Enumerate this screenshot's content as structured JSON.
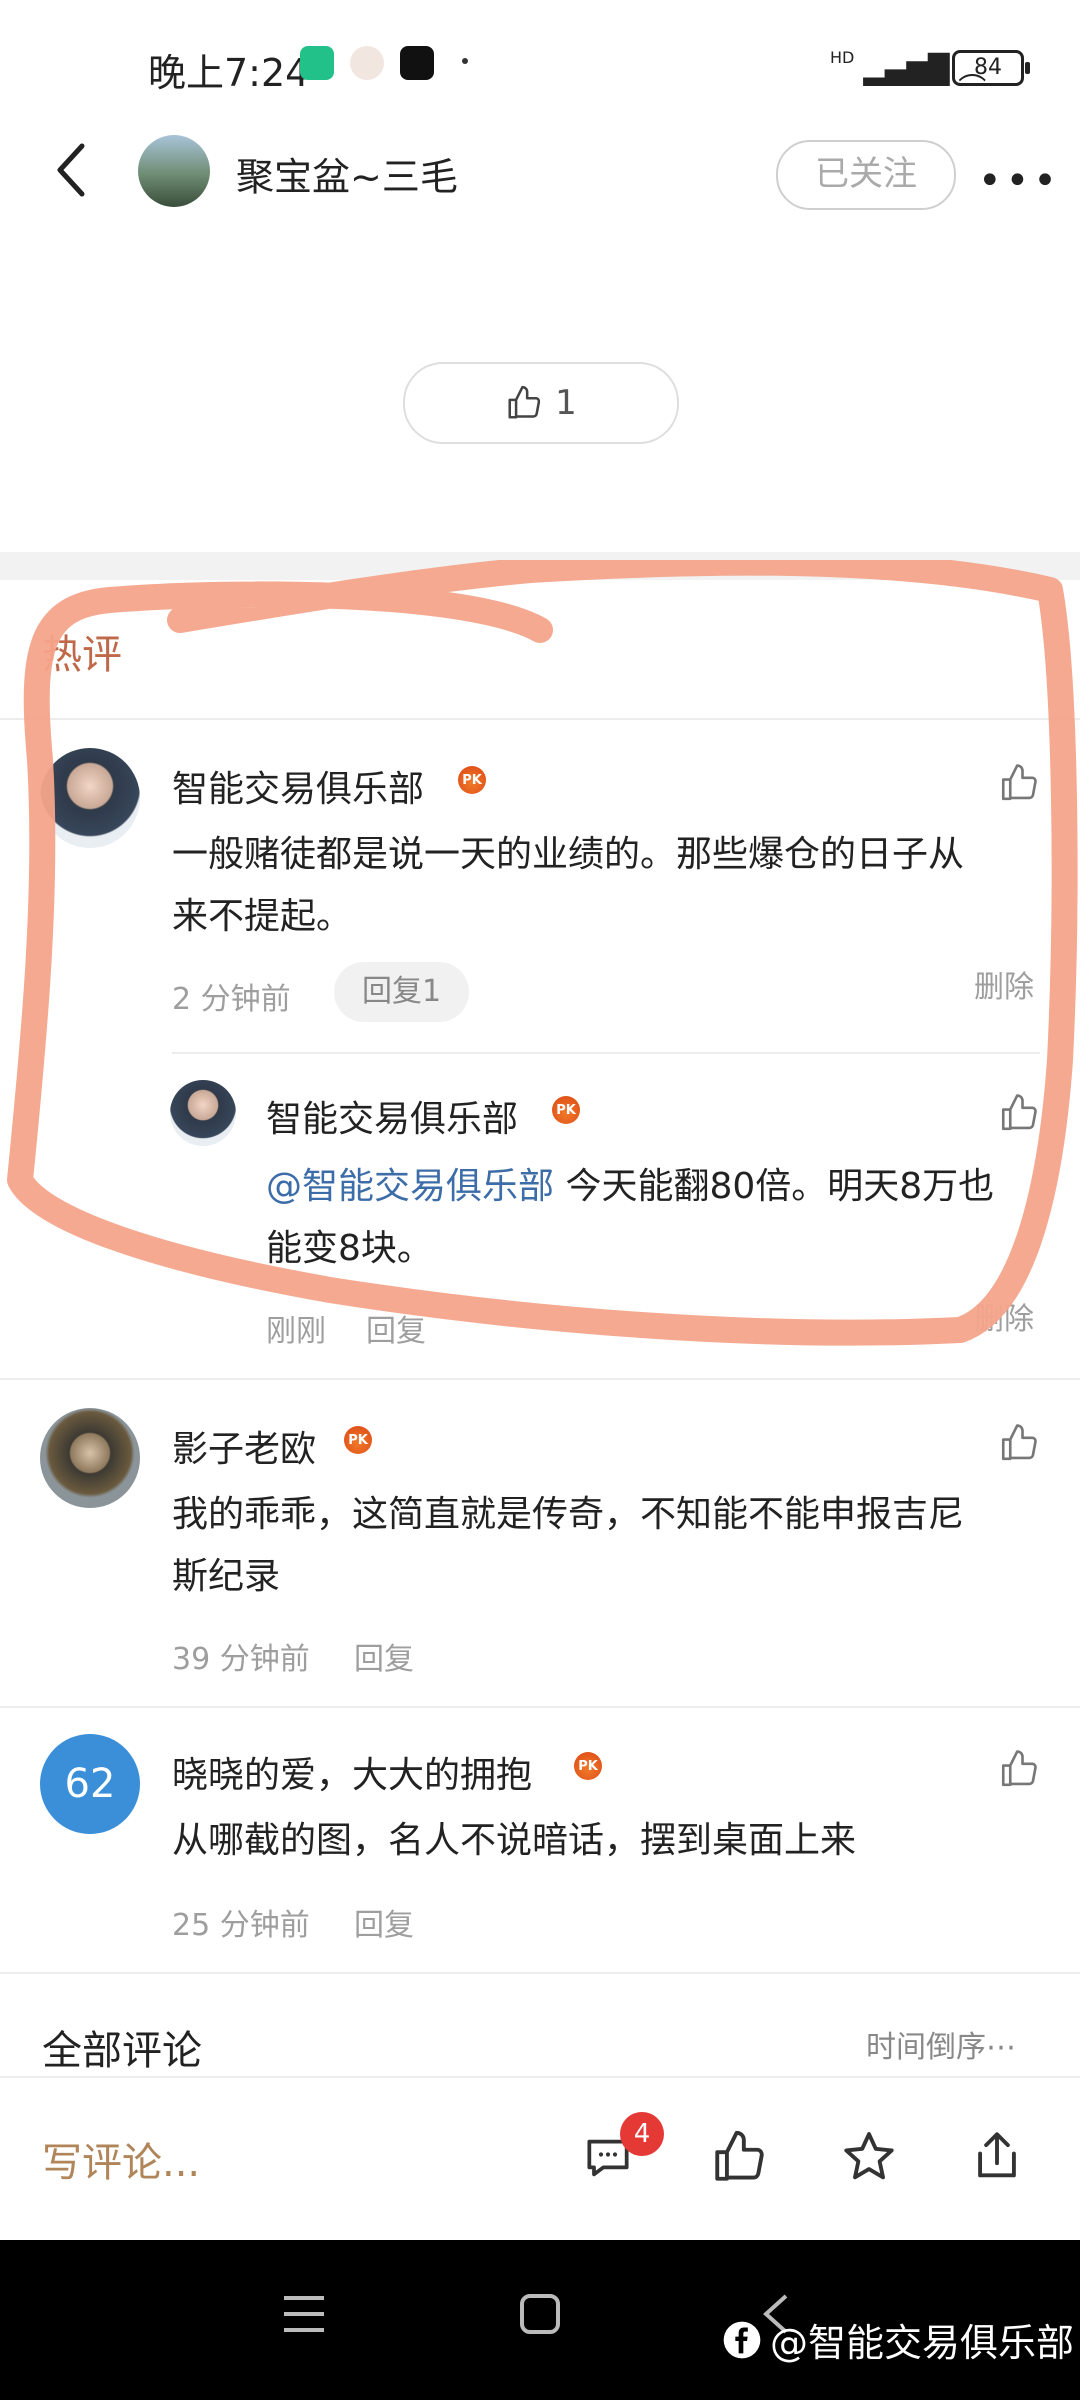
{
  "status_bar": {
    "time": "晚上7:24",
    "signal": "HD",
    "battery": "84"
  },
  "header": {
    "title": "聚宝盆~三毛",
    "follow_label": "已关注"
  },
  "post": {
    "like_count": "1"
  },
  "hot_section": {
    "title": "热评"
  },
  "comments": [
    {
      "name": "智能交易俱乐部",
      "text_line1": "一般赌徒都是说一天的业绩的。那些爆仓的日子从",
      "text_line2": "来不提起。",
      "time": "2 分钟前",
      "reply_label": "回复1",
      "delete_label": "删除"
    },
    {
      "name": "影子老欧",
      "text_line1": "我的乖乖，这简直就是传奇，不知能不能申报吉尼",
      "text_line2": "斯纪录",
      "time": "39 分钟前",
      "reply_label": "回复"
    },
    {
      "name": "晓晓的爱，大大的拥抱",
      "avatar_text": "62",
      "text_line1": "从哪截的图，名人不说暗话，摆到桌面上来",
      "time": "25 分钟前",
      "reply_label": "回复"
    }
  ],
  "reply": {
    "name": "智能交易俱乐部",
    "mention": "@智能交易俱乐部",
    "text_part1": " 今天能翻80倍。明天8万也",
    "text_line2": "能变8块。",
    "time": "刚刚",
    "reply_label": "回复",
    "delete_label": "删除"
  },
  "all_comments": {
    "title": "全部评论",
    "sort_label": "时间倒序⋯"
  },
  "bottom_bar": {
    "write_placeholder": "写评论...",
    "comment_badge": "4"
  },
  "watermark": {
    "text": "@智能交易俱乐部"
  },
  "colors": {
    "accent_orange": "#e2561b",
    "mention_blue": "#3d6da8",
    "highlight": "#f4a48a",
    "badge_red": "#e53935"
  }
}
